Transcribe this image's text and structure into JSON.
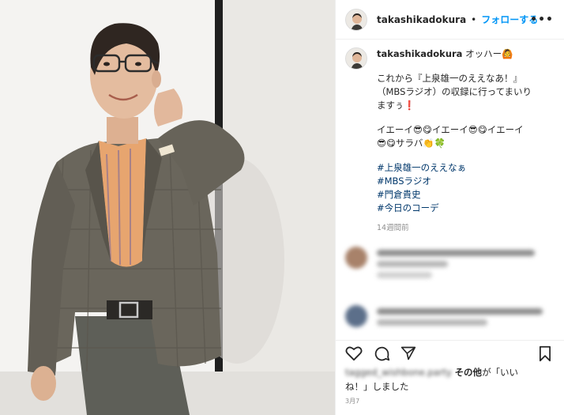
{
  "post": {
    "username": "takashikadokura",
    "follow_label": "フォローする",
    "separator": "•",
    "more_label": "•••",
    "caption_lead": "オッハー🙆",
    "caption_body": "これから『上泉雄一のええなあ！』\n（MBSラジオ）の収録に行ってまいり\nますぅ❗",
    "caption_body2": "イエーイ😎😋イエーイ😎😋イエーイ\n😎😋サラバ👏🍀",
    "hashtags": [
      "#上泉雄一のええなぁ",
      "#MBSラジオ",
      "#門倉貴史",
      "#今日のコーデ"
    ],
    "time_ago": "14週間前",
    "likes_prefix_blurred": "tagged_wishbone.party",
    "likes_others": "その他",
    "likes_suffix": "が「いい\nね！」しました",
    "post_date": "3月7"
  },
  "colors": {
    "accent": "#0095f6",
    "hashtag": "#00376b",
    "muted": "#8e8e8e",
    "border": "#efefef"
  },
  "icons": [
    "heart-icon",
    "comment-icon",
    "share-icon",
    "bookmark-icon",
    "more-icon"
  ]
}
